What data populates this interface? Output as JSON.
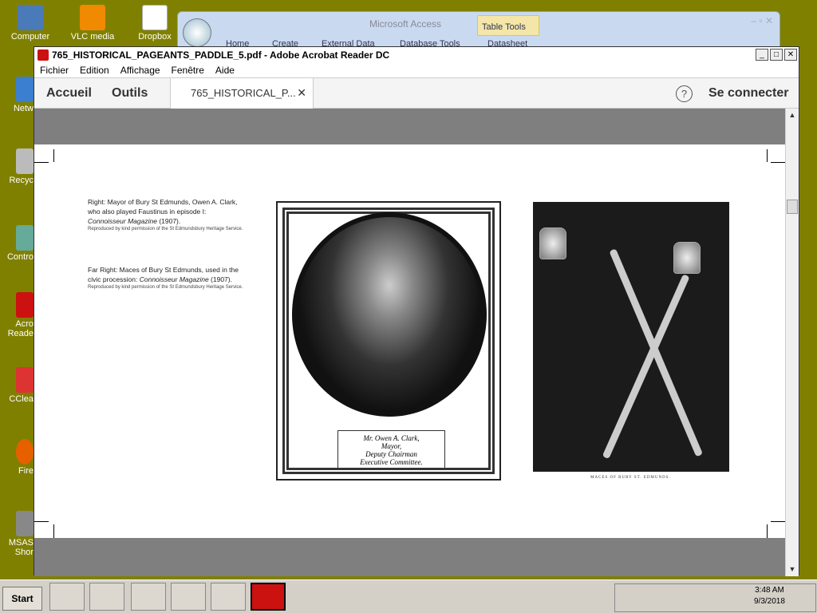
{
  "desktop": {
    "icons": [
      {
        "label": "Computer"
      },
      {
        "label": "VLC media"
      },
      {
        "label": "Dropbox"
      },
      {
        "label": "Netw"
      },
      {
        "label": "Recyc"
      },
      {
        "label": "Contro"
      },
      {
        "label": "Acro Reade"
      },
      {
        "label": "CClea"
      },
      {
        "label": "Fire"
      },
      {
        "label": "MSAS Shor"
      }
    ]
  },
  "access": {
    "title": "Microsoft Access",
    "table_tools": "Table Tools",
    "tabs": [
      "Home",
      "Create",
      "External Data",
      "Database Tools",
      "Datasheet"
    ]
  },
  "acrobat": {
    "title": "765_HISTORICAL_PAGEANTS_PADDLE_5.pdf - Adobe Acrobat Reader DC",
    "menu": [
      "Fichier",
      "Edition",
      "Affichage",
      "Fenêtre",
      "Aide"
    ],
    "nav_home": "Accueil",
    "nav_tools": "Outils",
    "doc_tab": "765_HISTORICAL_P...",
    "help": "?",
    "login": "Se connecter"
  },
  "page": {
    "caption1": {
      "text": "Right: Mayor of Bury St Edmunds, Owen A. Clark, who also played Faustinus in episode I:",
      "source": "Connoisseur Magazine",
      "year": " (1907).",
      "credit": "Reproduced by kind permission of the St Edmundsbury Heritage Service."
    },
    "caption2": {
      "text": "Far Right: Maces of Bury St Edmunds, used in the civic procession:",
      "source": "Connoisseur Magazine",
      "year": " (1907).",
      "credit": "Reproduced by kind permission of the St Edmundsbury Heritage Service."
    },
    "portrait_plate": [
      "Mr. Owen A. Clark,",
      "Mayor,",
      "Deputy Chairman",
      "Executive Committee."
    ],
    "maces_caption": "MACES OF BURY ST. EDMUNDS."
  },
  "taskbar": {
    "start": "Start",
    "time": "3:48 AM",
    "date": "9/3/2018"
  },
  "colors": {
    "desktop": "#808000",
    "acrobat_red": "#c11"
  }
}
